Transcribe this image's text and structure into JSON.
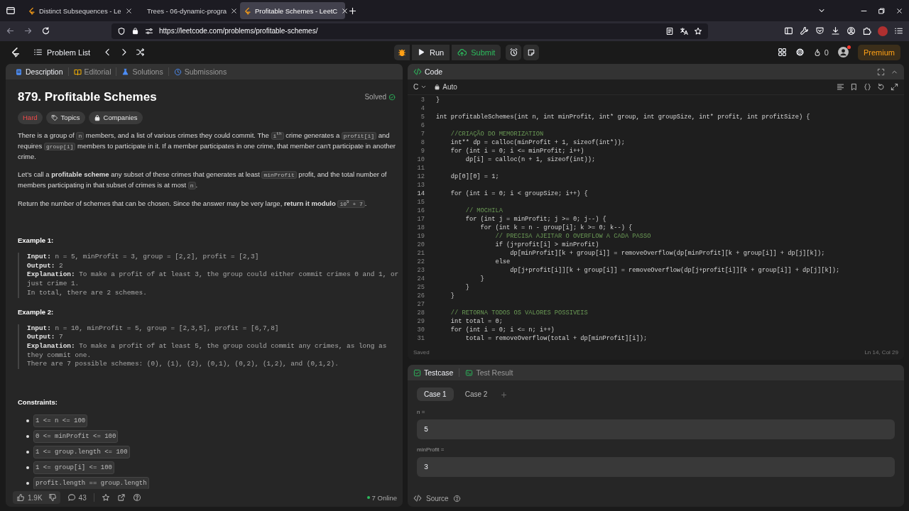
{
  "browser": {
    "tabs": [
      {
        "title": "Distinct Subsequences - Le",
        "favicon": true,
        "selected": false
      },
      {
        "title": "Trees - 06-dynamic-progra",
        "favicon": false,
        "selected": false
      },
      {
        "title": "Profitable Schemes - LeetC",
        "favicon": true,
        "selected": true
      }
    ],
    "url": "https://leetcode.com/problems/profitable-schemes/"
  },
  "nav": {
    "problem_list": "Problem List",
    "run": "Run",
    "submit": "Submit",
    "streak": "0",
    "premium": "Premium"
  },
  "description": {
    "tabs": [
      {
        "label": "Description",
        "selected": true
      },
      {
        "label": "Editorial",
        "selected": false
      },
      {
        "label": "Solutions",
        "selected": false
      },
      {
        "label": "Submissions",
        "selected": false
      }
    ],
    "title": "879. Profitable Schemes",
    "status": "Solved",
    "difficulty": "Hard",
    "tags": [
      {
        "label": "Topics",
        "kind": "topics"
      },
      {
        "label": "Companies",
        "kind": "companies"
      }
    ],
    "paragraphs": [
      [
        {
          "kind": "text",
          "text": "There is a group of "
        },
        {
          "kind": "code",
          "text": "n"
        },
        {
          "kind": "text",
          "text": " members, and a list of various crimes they could commit. The "
        },
        {
          "kind": "code",
          "text": "i$^{th}$"
        },
        {
          "kind": "text",
          "text": " crime generates a "
        },
        {
          "kind": "code",
          "text": "profit[i]"
        },
        {
          "kind": "text",
          "text": " and requires "
        },
        {
          "kind": "code",
          "text": "group[i]"
        },
        {
          "kind": "text",
          "text": " members to participate in it. If a member participates in one crime, that member can't participate in another crime."
        }
      ],
      [
        {
          "kind": "text",
          "text": "Let's call a **profitable scheme** any subset of these crimes that generates at least "
        },
        {
          "kind": "code",
          "text": "minProfit"
        },
        {
          "kind": "text",
          "text": " profit, and the total number of members participating in that subset of crimes is at most "
        },
        {
          "kind": "code",
          "text": "n"
        },
        {
          "kind": "text",
          "text": "."
        }
      ],
      [
        {
          "kind": "text",
          "text": "Return the number of schemes that can be chosen. Since the answer may be very large, **return it modulo** "
        },
        {
          "kind": "code",
          "text": "10$^{9}$ + 7"
        },
        {
          "kind": "text",
          "text": "."
        }
      ]
    ],
    "examples": [
      {
        "title": "Example 1:",
        "lines": [
          "**Input:** n = 5, minProfit = 3, group = [2,2], profit = [2,3]",
          "**Output:** 2",
          "**Explanation:** To make a profit of at least 3, the group could either commit crimes 0 and 1, or just crime 1.",
          "In total, there are 2 schemes."
        ]
      },
      {
        "title": "Example 2:",
        "lines": [
          "**Input:** n = 10, minProfit = 5, group = [2,3,5], profit = [6,7,8]",
          "**Output:** 7",
          "**Explanation:** To make a profit of at least 5, the group could commit any crimes, as long as they commit one.",
          "There are 7 possible schemes: (0), (1), (2), (0,1), (0,2), (1,2), and (0,1,2)."
        ]
      }
    ],
    "constraints_title": "Constraints:",
    "constraints": [
      "1 <= n <= 100",
      "0 <= minProfit <= 100",
      "1 <= group.length <= 100",
      "1 <= group[i] <= 100",
      "profit.length == group.length"
    ],
    "footer": {
      "likes": "1.9K",
      "comments": "43",
      "online": "7 Online"
    }
  },
  "code": {
    "title": "Code",
    "language": "C",
    "mode": "Auto",
    "lines": [
      {
        "num": "3",
        "kind": "code",
        "code": "}",
        "current": false
      },
      {
        "num": "4",
        "kind": "code",
        "current": false
      },
      {
        "num": "5",
        "kind": "code",
        "code": "int profitableSchemes(int n, int minProfit, int* group, int groupSize, int* profit, int profitSize) {",
        "current": false
      },
      {
        "num": "6",
        "kind": "code",
        "current": false
      },
      {
        "num": "7",
        "kind": "comment",
        "code": "    //CRIAÇÃO DO MEMORIZATION",
        "current": false
      },
      {
        "num": "8",
        "kind": "code",
        "code": "    int** dp = calloc(minProfit + 1, sizeof(int*));",
        "current": false
      },
      {
        "num": "9",
        "kind": "code",
        "code": "    for (int i = 0; i <= minProfit; i++)",
        "current": false
      },
      {
        "num": "10",
        "kind": "code",
        "code": "        dp[i] = calloc(n + 1, sizeof(int));",
        "current": false
      },
      {
        "num": "11",
        "kind": "code",
        "current": false
      },
      {
        "num": "12",
        "kind": "code",
        "code": "    dp[0][0] = 1;",
        "current": false
      },
      {
        "num": "13",
        "kind": "code",
        "current": false
      },
      {
        "num": "14",
        "kind": "code",
        "code": "    for (int i = 0; i < groupSize; i++) {",
        "current": true
      },
      {
        "num": "15",
        "kind": "code",
        "current": false
      },
      {
        "num": "16",
        "kind": "comment",
        "code": "        // MOCHILA",
        "current": false
      },
      {
        "num": "17",
        "kind": "code",
        "code": "        for (int j = minProfit; j >= 0; j--) {",
        "current": false
      },
      {
        "num": "18",
        "kind": "code",
        "code": "            for (int k = n - group[i]; k >= 0; k--) {",
        "current": false
      },
      {
        "num": "19",
        "kind": "comment",
        "code": "                // PRECISA AJEITAR O OVERFLOW A CADA PASSO",
        "current": false
      },
      {
        "num": "20",
        "kind": "code",
        "code": "                if (j+profit[i] > minProfit)",
        "current": false
      },
      {
        "num": "21",
        "kind": "code",
        "code": "                    dp[minProfit][k + group[i]] = removeOverflow(dp[minProfit][k + group[i]] + dp[j][k]);",
        "current": false
      },
      {
        "num": "22",
        "kind": "code",
        "code": "                else",
        "current": false
      },
      {
        "num": "23",
        "kind": "code",
        "code": "                    dp[j+profit[i]][k + group[i]] = removeOverflow(dp[j+profit[i]][k + group[i]] + dp[j][k]);",
        "current": false
      },
      {
        "num": "24",
        "kind": "code",
        "code": "            }",
        "current": false
      },
      {
        "num": "25",
        "kind": "code",
        "code": "        }",
        "current": false
      },
      {
        "num": "26",
        "kind": "code",
        "code": "    }",
        "current": false
      },
      {
        "num": "27",
        "kind": "code",
        "current": false
      },
      {
        "num": "28",
        "kind": "comment",
        "code": "    // RETORNA TODOS OS VALORES POSSIVEIS",
        "current": false
      },
      {
        "num": "29",
        "kind": "code",
        "code": "    int total = 0;",
        "current": false
      },
      {
        "num": "30",
        "kind": "code",
        "code": "    for (int i = 0; i <= n; i++)",
        "current": false
      },
      {
        "num": "31",
        "kind": "code",
        "code": "        total = removeOverflow(total + dp[minProfit][i]);",
        "current": false
      }
    ],
    "save_status": "Saved",
    "position": "Ln 14, Col 29"
  },
  "testcase": {
    "tabs": [
      {
        "label": "Testcase",
        "selected": true
      },
      {
        "label": "Test Result",
        "selected": false
      }
    ],
    "cases": [
      {
        "label": "Case 1",
        "selected": true
      },
      {
        "label": "Case 2",
        "selected": false
      }
    ],
    "add": "+",
    "params": [
      {
        "name": "n =",
        "value": "5"
      },
      {
        "name": "minProfit =",
        "value": "3"
      }
    ],
    "source": "Source"
  }
}
